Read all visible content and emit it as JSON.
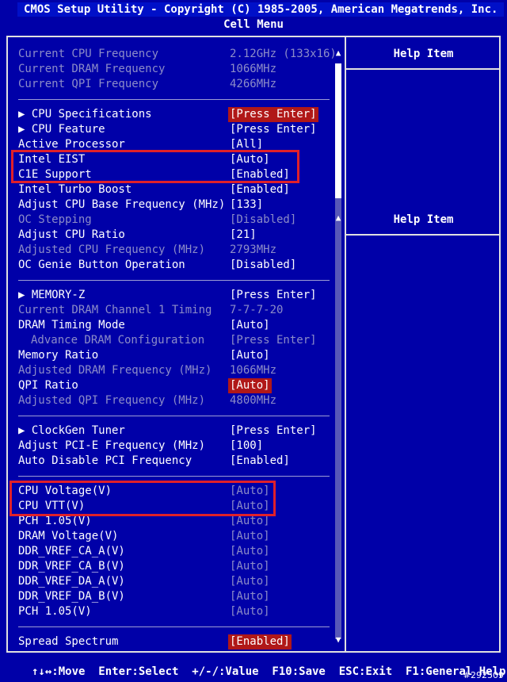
{
  "title": {
    "line1": "CMOS Setup Utility - Copyright (C) 1985-2005, American Megatrends, Inc.",
    "line2": "Cell Menu"
  },
  "help": {
    "head1": "Help Item",
    "head2": "Help Item"
  },
  "rows": [
    {
      "label": "Current CPU Frequency",
      "value": "2.12GHz (133x16)"
    },
    {
      "label": "Current DRAM Frequency",
      "value": "1066MHz"
    },
    {
      "label": "Current QPI Frequency",
      "value": "4266MHz"
    },
    {
      "label": "▶ CPU Specifications",
      "value": "[Press Enter]"
    },
    {
      "label": "▶ CPU Feature",
      "value": "[Press Enter]"
    },
    {
      "label": "Active Processor",
      "value": "[All]"
    },
    {
      "label": "Intel EIST",
      "value": "[Auto]"
    },
    {
      "label": "C1E Support",
      "value": "[Enabled]"
    },
    {
      "label": "Intel Turbo Boost",
      "value": "[Enabled]"
    },
    {
      "label": "Adjust CPU Base Frequency (MHz)",
      "value": "[133]"
    },
    {
      "label": "OC Stepping",
      "value": "[Disabled]"
    },
    {
      "label": "Adjust CPU Ratio",
      "value": "[21]"
    },
    {
      "label": "Adjusted CPU Frequency (MHz)",
      "value": "2793MHz"
    },
    {
      "label": "OC Genie Button Operation",
      "value": "[Disabled]"
    },
    {
      "label": "▶ MEMORY-Z",
      "value": "[Press Enter]"
    },
    {
      "label": "Current DRAM Channel 1 Timing",
      "value": "7-7-7-20"
    },
    {
      "label": "DRAM Timing Mode",
      "value": "[Auto]"
    },
    {
      "label": "Advance DRAM Configuration",
      "value": "[Press Enter]"
    },
    {
      "label": "Memory Ratio",
      "value": "[Auto]"
    },
    {
      "label": "Adjusted DRAM Frequency (MHz)",
      "value": "1066MHz"
    },
    {
      "label": "QPI Ratio",
      "value": "[Auto]"
    },
    {
      "label": "Adjusted QPI Frequency (MHz)",
      "value": "4800MHz"
    },
    {
      "label": "▶ ClockGen Tuner",
      "value": "[Press Enter]"
    },
    {
      "label": "Adjust PCI-E Frequency (MHz)",
      "value": "[100]"
    },
    {
      "label": "Auto Disable PCI Frequency",
      "value": "[Enabled]"
    },
    {
      "label": "CPU Voltage(V)",
      "value": "[Auto]"
    },
    {
      "label": "CPU VTT(V)",
      "value": "[Auto]"
    },
    {
      "label": "PCH 1.05(V)",
      "value": "[Auto]"
    },
    {
      "label": "DRAM Voltage(V)",
      "value": "[Auto]"
    },
    {
      "label": "DDR_VREF_CA_A(V)",
      "value": "[Auto]"
    },
    {
      "label": "DDR_VREF_CA_B(V)",
      "value": "[Auto]"
    },
    {
      "label": "DDR_VREF_DA_A(V)",
      "value": "[Auto]"
    },
    {
      "label": "DDR_VREF_DA_B(V)",
      "value": "[Auto]"
    },
    {
      "label": "PCH 1.05(V)",
      "value": "[Auto]"
    },
    {
      "label": "Spread Spectrum",
      "value": "[Enabled]"
    }
  ],
  "status": "↑↓↔:Move  Enter:Select  +/-/:Value  F10:Save  ESC:Exit  F1:General Help",
  "watermark": "#292509",
  "colors": {
    "background": "#0000a8",
    "selected": "#b01818",
    "highlight_box": "#e0202a",
    "dim_text": "#8c8cc8"
  },
  "icons": {
    "scroll_up": "up-arrow-icon",
    "scroll_down": "down-arrow-icon",
    "submenu": "triangle-right-icon"
  }
}
